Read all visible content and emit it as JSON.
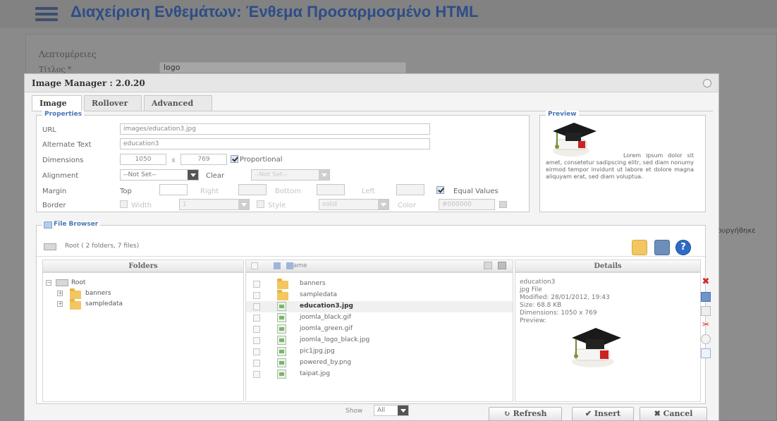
{
  "background": {
    "page_title": "Διαχείριση Ενθεμάτων: Ένθεμα Προσαρμοσμένο HTML",
    "fieldset_label": "Λεπτομέρειες",
    "field_label": "Τίτλος *",
    "field_value": "logo",
    "cut_off_text": "ιουργήθηκε"
  },
  "dialog": {
    "title": "Image Manager : 2.0.20",
    "tabs": [
      "Image",
      "Rollover",
      "Advanced"
    ],
    "properties": {
      "legend": "Properties",
      "url_label": "URL",
      "url_value": "images/education3.jpg",
      "alt_label": "Alternate Text",
      "alt_value": "education3",
      "dimensions_label": "Dimensions",
      "width_value": "1050",
      "times": "x",
      "height_value": "769",
      "proportional_label": "Proportional",
      "alignment_label": "Alignment",
      "alignment_value": "--Not Set--",
      "clear_label": "Clear",
      "clear_value": "--Not Set--",
      "margin_label": "Margin",
      "top_label": "Top",
      "right_label": "Right",
      "bottom_label": "Bottom",
      "left_label": "Left",
      "equal_values_label": "Equal Values",
      "border_label": "Border",
      "width_label": "Width",
      "width_select": "1",
      "style_label": "Style",
      "style_select": "solid",
      "color_label": "Color",
      "color_value": "#000000"
    },
    "preview": {
      "legend": "Preview",
      "text": "Lorem ipsum dolor sit amet, consetetur sadipscing elitr, sed diam nonumy eirmod tempor invidunt ut labore et dolore magna aliquyam erat, sed diam voluptua."
    },
    "file_browser": {
      "legend": "File Browser",
      "path": "Root  ( 2 folders, 7 files)",
      "folders_header": "Folders",
      "name_header": "Name",
      "details_header": "Details",
      "tree": {
        "root": "Root",
        "children": [
          "banners",
          "sampledata"
        ]
      },
      "files": [
        {
          "name": "banners",
          "type": "folder"
        },
        {
          "name": "sampledata",
          "type": "folder"
        },
        {
          "name": "education3.jpg",
          "type": "file",
          "selected": true
        },
        {
          "name": "joomla_black.gif",
          "type": "file"
        },
        {
          "name": "joomla_green.gif",
          "type": "file"
        },
        {
          "name": "joomla_logo_black.jpg",
          "type": "file"
        },
        {
          "name": "pic1jpg.jpg",
          "type": "file"
        },
        {
          "name": "powered_by.png",
          "type": "file"
        },
        {
          "name": "taipat.jpg",
          "type": "file"
        }
      ],
      "details": {
        "name": "education3",
        "type": "jpg File",
        "modified": "Modified: 28/01/2012, 19:43",
        "size": "Size: 68.8 KB",
        "dimensions": "Dimensions: 1050 x 769",
        "preview_label": "Preview:"
      },
      "show_label": "Show",
      "show_value": "All"
    },
    "buttons": {
      "refresh": "Refresh",
      "insert": "Insert",
      "cancel": "Cancel"
    }
  }
}
